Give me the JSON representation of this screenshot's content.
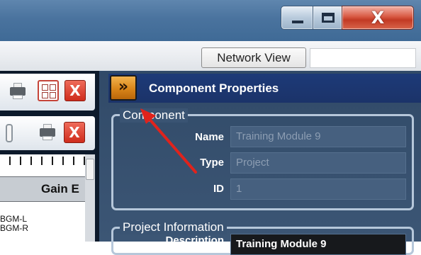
{
  "window": {
    "controls": {
      "minimize_icon": "minimize-icon",
      "maximize_icon": "maximize-icon",
      "close_glyph": "X"
    }
  },
  "toolbar": {
    "network_view_label": "Network View"
  },
  "left_panel": {
    "gain_header": "Gain E",
    "close_glyph": "X",
    "channels": [
      "BGM-L",
      "BGM-R"
    ]
  },
  "component_panel": {
    "header_title": "Component Properties",
    "expand_glyph": "»",
    "component_group": {
      "label": "Component",
      "fields": {
        "name": {
          "label": "Name",
          "value": "Training Module 9"
        },
        "type": {
          "label": "Type",
          "value": "Project"
        },
        "id": {
          "label": "ID",
          "value": "1"
        }
      }
    },
    "project_group": {
      "label": "Project Information",
      "description_label": "Description",
      "description_value": "Training Module 9"
    }
  },
  "colors": {
    "header_blue": "#1d3a78",
    "panel_bg": "#3a5473",
    "annotation_arrow": "#e0231c",
    "close_red": "#d95a44"
  }
}
